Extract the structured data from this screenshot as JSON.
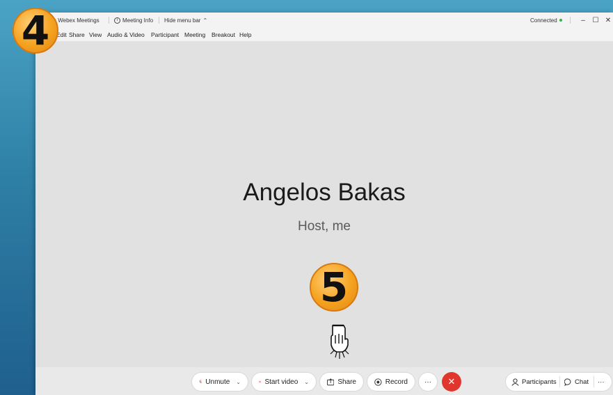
{
  "titlebar": {
    "app_title": "Cisco Webex Meetings",
    "meeting_info": "Meeting Info",
    "hide_menu": "Hide menu bar",
    "status": "Connected"
  },
  "menubar": {
    "items": [
      "Edit",
      "Share",
      "View",
      "Audio & Video",
      "Participant",
      "Meeting",
      "Breakout",
      "Help"
    ]
  },
  "stage": {
    "name": "Angelos Bakas",
    "role": "Host, me"
  },
  "toolbar": {
    "unmute": "Unmute",
    "start_video": "Start video",
    "share": "Share",
    "record": "Record",
    "more": "···",
    "participants": "Participants",
    "chat": "Chat",
    "more_right": "···"
  },
  "annotations": {
    "badge_a": "4",
    "badge_b": "5"
  },
  "colors": {
    "end_call": "#e0362d",
    "connected": "#2eb34a",
    "badge": "#f5a21e"
  }
}
